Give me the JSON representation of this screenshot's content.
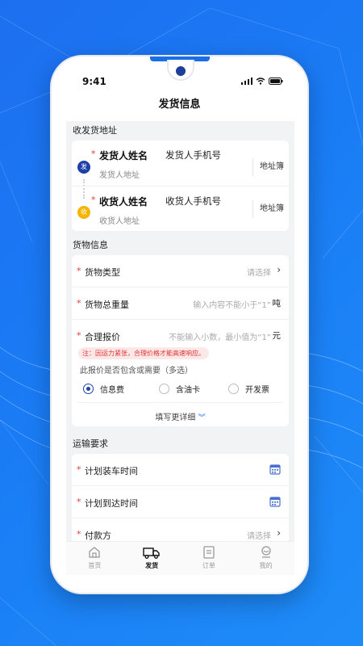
{
  "status": {
    "time": "9:41"
  },
  "nav": {
    "title": "发货信息"
  },
  "address": {
    "section_title": "收发货地址",
    "sender": {
      "badge": "发",
      "name": "发货人姓名",
      "phone": "发货人手机号",
      "address": "发货人地址",
      "book": "地址簿"
    },
    "receiver": {
      "badge": "收",
      "name": "收货人姓名",
      "phone": "收货人手机号",
      "address": "收货人地址",
      "book": "地址簿"
    }
  },
  "cargo": {
    "section_title": "货物信息",
    "type": {
      "label": "货物类型",
      "placeholder": "请选择"
    },
    "weight": {
      "label": "货物总重量",
      "placeholder": "输入内容不能小于“1”",
      "unit": "吨"
    },
    "price": {
      "label": "合理报价",
      "placeholder": "不能输入小数，最小值为“1”",
      "unit": "元"
    },
    "note": "注：因运力紧张，合理价格才能高速响应。",
    "question": "此报价是否包含或需要（多选）",
    "options": [
      {
        "label": "信息费",
        "checked": true
      },
      {
        "label": "含油卡",
        "checked": false
      },
      {
        "label": "开发票",
        "checked": false
      }
    ],
    "more": "填写更详细"
  },
  "transport": {
    "section_title": "运输要求",
    "load_time": {
      "label": "计划装车时间"
    },
    "arrive_time": {
      "label": "计划到达时间"
    },
    "payer": {
      "label": "付款方",
      "placeholder": "请选择"
    }
  },
  "tabs": [
    {
      "label": "首页",
      "icon": "home-icon"
    },
    {
      "label": "发货",
      "icon": "truck-icon"
    },
    {
      "label": "订单",
      "icon": "order-icon"
    },
    {
      "label": "我的",
      "icon": "user-icon"
    }
  ],
  "colors": {
    "accent": "#1d3fa8",
    "required": "#e23b3b",
    "background": "#1a7cf5"
  }
}
